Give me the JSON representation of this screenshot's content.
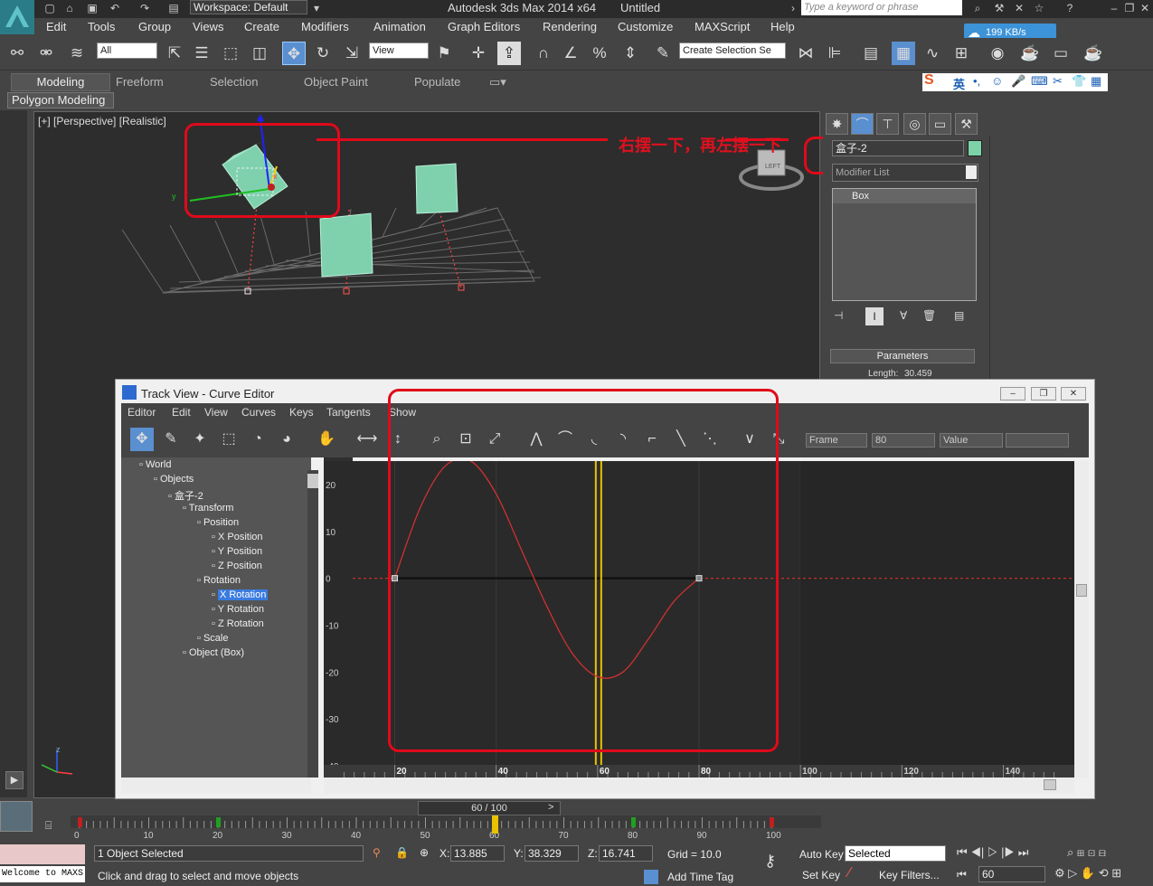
{
  "title_bar": {
    "workspace": "Workspace: Default",
    "app_title": "Autodesk 3ds Max  2014 x64",
    "file": "Untitled",
    "search_placeholder": "Type a keyword or phrase"
  },
  "menu": [
    "Edit",
    "Tools",
    "Group",
    "Views",
    "Create",
    "Modifiers",
    "Animation",
    "Graph Editors",
    "Rendering",
    "Customize",
    "MAXScript",
    "Help"
  ],
  "main_toolbar": {
    "filter_select": "All",
    "view_select": "View",
    "selection_set": "Create Selection Se"
  },
  "network_speed": "199 KB/s",
  "ribbon": {
    "tabs": [
      "Modeling",
      "Freeform",
      "Selection",
      "Object Paint",
      "Populate"
    ],
    "sub_label": "Polygon Modeling"
  },
  "ime": {
    "lang": "英"
  },
  "viewport": {
    "label": "[+] [Perspective] [Realistic]",
    "viewcube_label": "LEFT",
    "annotation": "右摆一下，再左摆一下",
    "axis_labels": {
      "x": "x",
      "y": "y",
      "z": "z"
    }
  },
  "command_panel": {
    "object_name": "盒子-2",
    "modifier_list": "Modifier List",
    "stack_item": "Box",
    "rollout": "Parameters",
    "length_label": "Length:",
    "length_value": "30.459",
    "object_color": "#7cd3a8"
  },
  "track_view": {
    "title": "Track View - Curve Editor",
    "menu": [
      "Editor",
      "Edit",
      "View",
      "Curves",
      "Keys",
      "Tangents",
      "Show"
    ],
    "frame_label": "Frame",
    "frame_value": "80",
    "value_label": "Value",
    "value_value": "",
    "tree": [
      {
        "label": "World",
        "indent": 0
      },
      {
        "label": "Objects",
        "indent": 1
      },
      {
        "label": "盒子-2",
        "indent": 2
      },
      {
        "label": "Transform",
        "indent": 3
      },
      {
        "label": "Position",
        "indent": 4
      },
      {
        "label": "X Position",
        "indent": 5
      },
      {
        "label": "Y Position",
        "indent": 5
      },
      {
        "label": "Z Position",
        "indent": 5
      },
      {
        "label": "Rotation",
        "indent": 4
      },
      {
        "label": "X Rotation",
        "indent": 5,
        "selected": true
      },
      {
        "label": "Y Rotation",
        "indent": 5
      },
      {
        "label": "Z Rotation",
        "indent": 5
      },
      {
        "label": "Scale",
        "indent": 4
      },
      {
        "label": "Object (Box)",
        "indent": 3
      }
    ],
    "y_ticks": [
      "20",
      "10",
      "0",
      "-10",
      "-20",
      "-30",
      "-40"
    ],
    "x_ticks": [
      "20",
      "40",
      "60",
      "80",
      "100",
      "120",
      "140"
    ],
    "current_frame": 60
  },
  "chart_data": {
    "type": "line",
    "title": "",
    "xlabel": "",
    "ylabel": "",
    "xlim": [
      6,
      154
    ],
    "ylim": [
      -40,
      25
    ],
    "series": [
      {
        "name": "X Rotation",
        "x": [
          20,
          25,
          30,
          35,
          40,
          45,
          50,
          55,
          60,
          65,
          70,
          75,
          80
        ],
        "y": [
          0,
          15,
          24,
          25,
          18,
          6,
          -6,
          -16,
          -21,
          -20,
          -13,
          -5,
          0
        ],
        "color": "#d03030"
      }
    ],
    "keys": [
      {
        "x": 20,
        "y": 0
      },
      {
        "x": 80,
        "y": 0
      }
    ]
  },
  "timeline": {
    "slider": "60 / 100",
    "ticks": [
      "0",
      "10",
      "20",
      "30",
      "40",
      "50",
      "60",
      "70",
      "80",
      "90",
      "100"
    ]
  },
  "status": {
    "welcome": "Welcome to MAXS",
    "selected": "1 Object Selected",
    "prompt": "Click and drag to select and move objects",
    "x_label": "X:",
    "x": "13.885",
    "y_label": "Y:",
    "y": "38.329",
    "z_label": "Z:",
    "z": "16.741",
    "grid": "Grid = 10.0",
    "auto_key": "Auto Key",
    "set_key": "Set Key",
    "key_mode": "Selected",
    "key_filters": "Key Filters...",
    "add_time_tag": "Add Time Tag",
    "frame": "60"
  }
}
